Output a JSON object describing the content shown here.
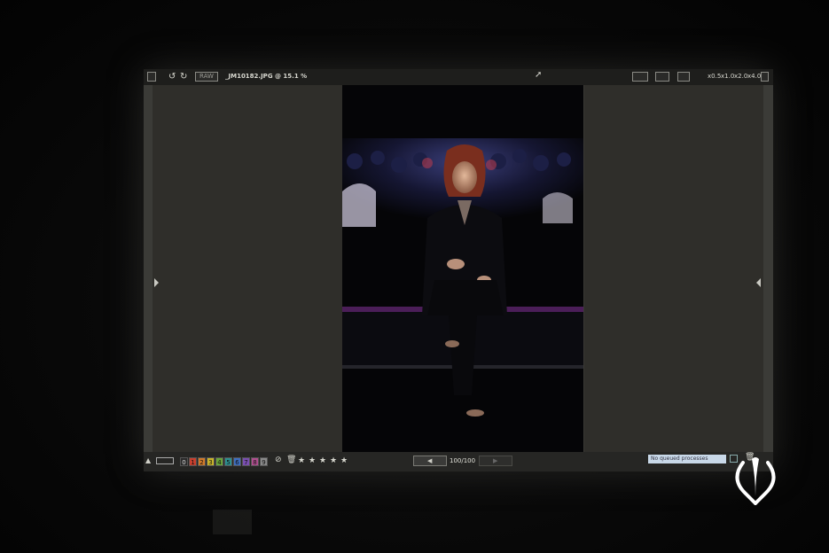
{
  "toolbar": {
    "raw_badge": "RAW",
    "file_label": "_JM10182.JPG @ 15.1 %",
    "zoom_options": [
      "x0.5",
      "x1.0",
      "x2.0",
      "x4.0"
    ]
  },
  "bottom_bar": {
    "color_labels": [
      "0",
      "1",
      "2",
      "3",
      "4",
      "5",
      "6",
      "7",
      "8",
      "9"
    ],
    "label_colors": [
      "#2a2a2a",
      "#c8402e",
      "#d07a2a",
      "#c9b42a",
      "#6aa43a",
      "#2e8f8f",
      "#3f6fc0",
      "#7a4fb0",
      "#b04f8f",
      "#8a8a8a"
    ],
    "rating_stars": 5,
    "counter": "100/100",
    "queue_status": "No queued processes"
  },
  "icons": {
    "menu": "menu-icon",
    "rotate_left": "rotate-left-icon",
    "rotate_right": "rotate-right-icon",
    "cursor": "cursor-icon",
    "delete": "trash-icon",
    "reject": "reject-icon"
  }
}
